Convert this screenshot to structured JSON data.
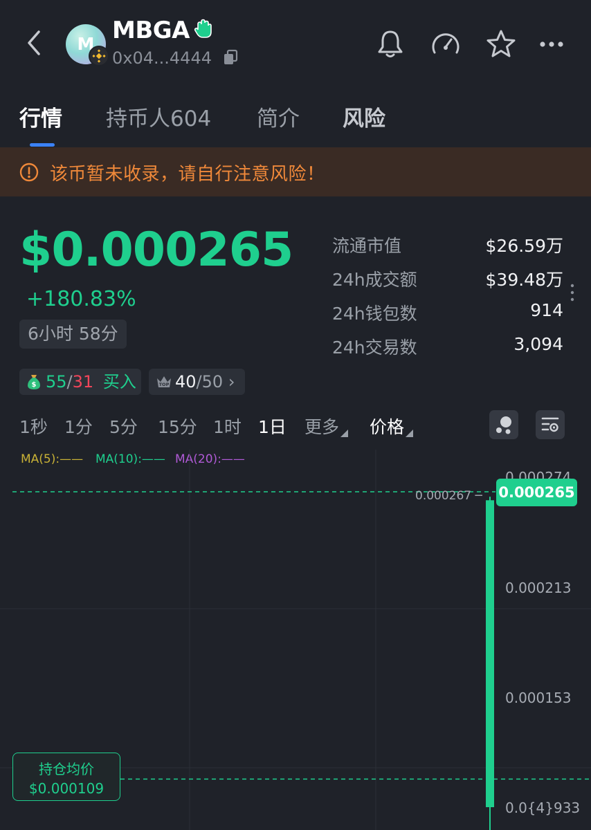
{
  "header": {
    "token_name": "MBGA",
    "avatar_letter": "M",
    "address": "0x04...4444",
    "icons": [
      "back-arrow-icon",
      "bnb-chain-icon",
      "verified-hand-icon",
      "copy-icon",
      "bell-icon",
      "gauge-icon",
      "star-icon",
      "more-icon"
    ]
  },
  "tabs": [
    {
      "label": "行情"
    },
    {
      "label": "持币人604"
    },
    {
      "label": "简介"
    },
    {
      "label": "风险"
    }
  ],
  "warning": {
    "text": "该币暂未收录，请自行注意风险！",
    "color": "#f0893a"
  },
  "price": {
    "value": "$0.000265",
    "change": "+180.83%",
    "age": "6小时 58分"
  },
  "stats": [
    {
      "label": "流通市值",
      "value": "$26.59万"
    },
    {
      "label": "24h成交额",
      "value": "$39.48万"
    },
    {
      "label": "24h钱包数",
      "value": "914"
    },
    {
      "label": "24h交易数",
      "value": "3,094"
    }
  ],
  "chips": {
    "trades_buy": "55",
    "trades_sep": "/",
    "trades_sell": "31",
    "trades_label": "买入",
    "top_count": "40",
    "top_sep": "/",
    "top_total": "50",
    "top_chevron": "›"
  },
  "intervals": [
    "1秒",
    "1分",
    "5分",
    "15分",
    "1时",
    "1日"
  ],
  "selected_interval": "1日",
  "more_label": "更多",
  "price_label": "价格",
  "ma_legend": [
    {
      "label": "MA(5):——",
      "color": "#c9b236"
    },
    {
      "label": "MA(10):——",
      "color": "#1fcf8e"
    },
    {
      "label": "MA(20):——",
      "color": "#b05ad6"
    }
  ],
  "chart": {
    "y_labels": [
      "0.000274",
      "0.000213",
      "0.000153",
      "0.0{4}933"
    ],
    "high_marker": "0.000267",
    "last_price": "0.000265",
    "avg_cost_label": "持仓均价",
    "avg_cost_value": "$0.000109",
    "colors": {
      "up": "#1fcf8e",
      "grid": "#2b2f36"
    }
  },
  "chart_data": {
    "type": "candlestick",
    "x": [
      "1日"
    ],
    "candles": [
      {
        "open": 9.33e-05,
        "high": 0.000267,
        "low": 9.33e-05,
        "close": 0.000265
      }
    ],
    "y_ticks": [
      0.000274,
      0.000213,
      0.000153,
      9.33e-05
    ],
    "reference_lines": [
      {
        "name": "持仓均价",
        "value": 0.000109
      }
    ],
    "grid": true
  }
}
